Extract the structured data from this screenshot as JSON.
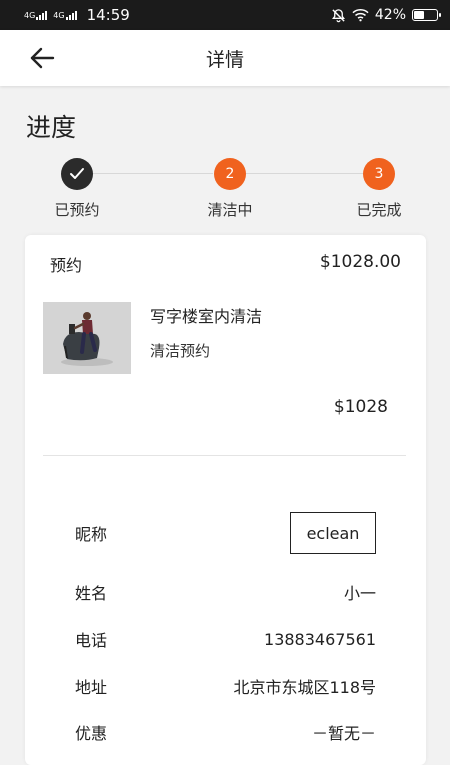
{
  "status_bar": {
    "signal1": "4G",
    "signal2": "4G",
    "time": "14:59",
    "battery": "42%",
    "icons": [
      "mute-icon",
      "wifi-icon",
      "battery-icon"
    ]
  },
  "app_bar": {
    "back_icon": "arrow-left-icon",
    "title": "详情"
  },
  "section_title": "进度",
  "progress": {
    "steps": [
      {
        "label": "已预约",
        "mark": "✓",
        "state": "done",
        "color": "#2b2b2b"
      },
      {
        "label": "清洁中",
        "mark": "2",
        "state": "pending",
        "color": "#f0621e"
      },
      {
        "label": "已完成",
        "mark": "3",
        "state": "pending",
        "color": "#f0621e"
      }
    ]
  },
  "order": {
    "type_label": "预约",
    "total": "$1028.00",
    "product": {
      "name": "写字楼室内清洁",
      "subtitle": "清洁预约"
    },
    "subtotal": "$1028"
  },
  "details": [
    {
      "key": "昵称",
      "value": "eclean"
    },
    {
      "key": "姓名",
      "value": "小一"
    },
    {
      "key": "电话",
      "value": "13883467561"
    },
    {
      "key": "地址",
      "value": "北京市东城区118号"
    },
    {
      "key": "优惠",
      "value": "－暂无－"
    }
  ]
}
